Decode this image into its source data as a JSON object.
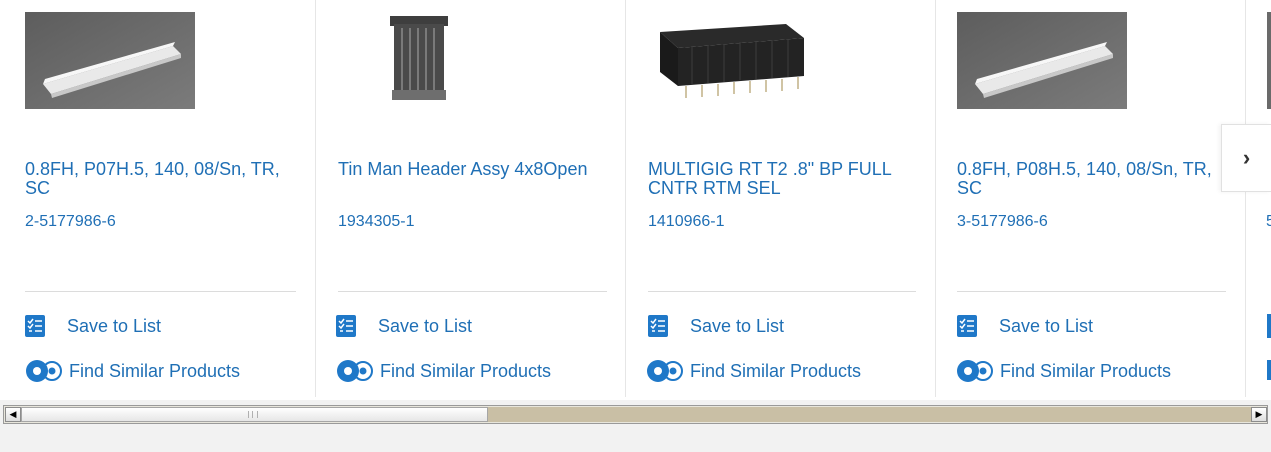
{
  "products": [
    {
      "title": "0.8FH, P07H.5, 140, 08/Sn, TR, SC",
      "part_number": "2-5177986-6",
      "image": "white-edge-connector",
      "save_label": "Save to List",
      "similar_label": "Find Similar Products"
    },
    {
      "title": "Tin Man Header Assy 4x8Open",
      "part_number": "1934305-1",
      "image": "gray-header-assembly",
      "save_label": "Save to List",
      "similar_label": "Find Similar Products"
    },
    {
      "title": "MULTIGIG RT T2 .8\" BP FULL CNTR RTM SEL",
      "part_number": "1410966-1",
      "image": "black-multipin-connector",
      "save_label": "Save to List",
      "similar_label": "Find Similar Products"
    },
    {
      "title": "0.8FH, P08H.5, 140, 08/Sn, TR, SC",
      "part_number": "3-5177986-6",
      "image": "white-edge-connector",
      "save_label": "Save to List",
      "similar_label": "Find Similar Products"
    }
  ],
  "partial_card": {
    "part_number_fragment": "5"
  },
  "carousel": {
    "next_icon": "chevron-right-icon",
    "next_glyph": "›"
  },
  "colors": {
    "link": "#1f6fb5",
    "icon": "#1f78c8",
    "scroll_track": "#c9bfa5"
  }
}
